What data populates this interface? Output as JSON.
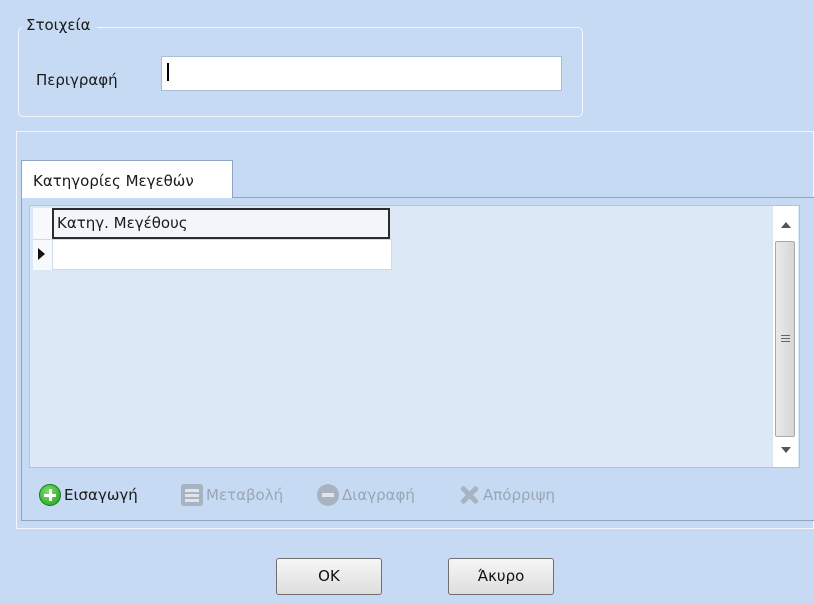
{
  "details": {
    "group_title": "Στοιχεία",
    "description_label": "Περιγραφή",
    "description_value": ""
  },
  "tabs": [
    {
      "label": "Κατηγορίες Μεγεθών",
      "selected": true
    }
  ],
  "grid": {
    "columns": [
      "Κατηγ. Μεγέθους"
    ],
    "rows": [
      [
        ""
      ]
    ]
  },
  "toolbar": {
    "insert": {
      "label": "Εισαγωγή",
      "icon": "plus-circle-icon",
      "enabled": true,
      "color": "#1f9b1f"
    },
    "modify": {
      "label": "Μεταβολή",
      "icon": "edit-icon",
      "enabled": false
    },
    "delete": {
      "label": "Διαγραφή",
      "icon": "minus-circle-icon",
      "enabled": false
    },
    "discard": {
      "label": "Απόρριψη",
      "icon": "x-cross-icon",
      "enabled": false
    }
  },
  "buttons": {
    "ok": "OK",
    "cancel": "Άκυρο"
  },
  "colors": {
    "background": "#c7daf3",
    "grid_background": "#dde8f6",
    "disabled_text": "#9aa6b5"
  }
}
